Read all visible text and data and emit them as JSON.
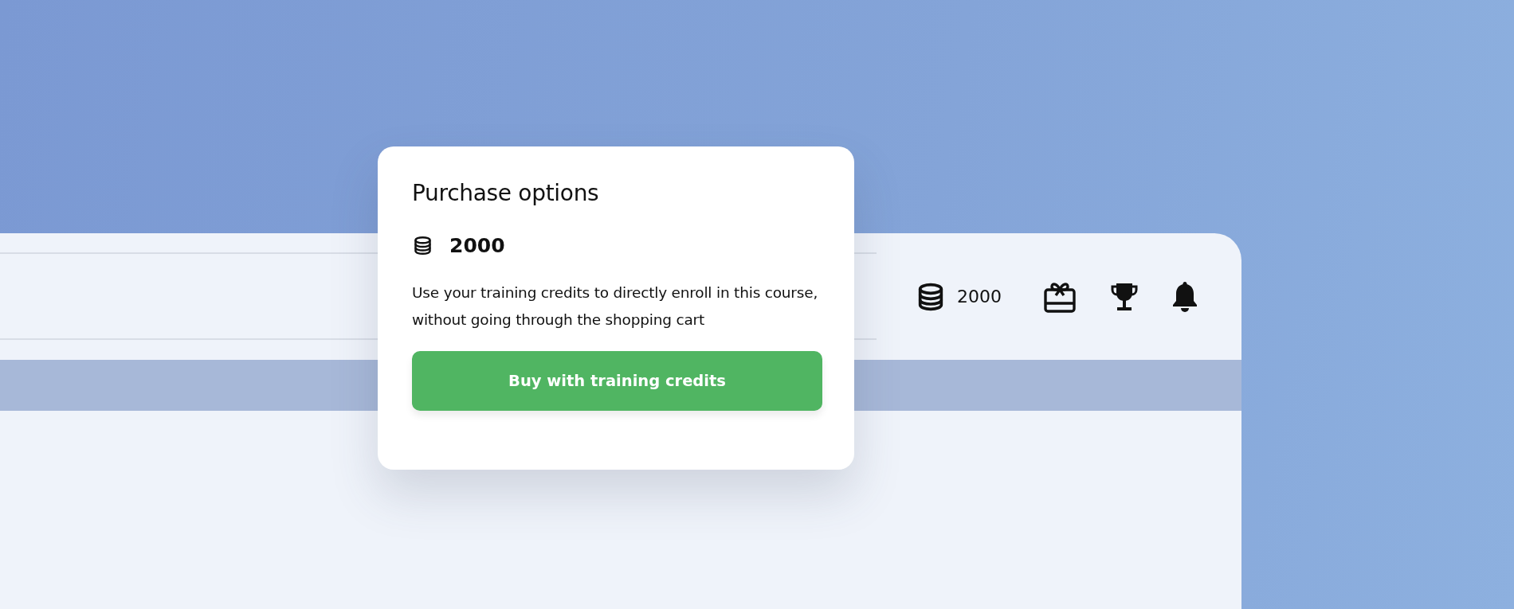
{
  "header": {
    "credits": "2000"
  },
  "popup": {
    "title": "Purchase options",
    "credits": "2000",
    "description": "Use your training credits to directly enroll in this course, without going through the shopping cart",
    "button": "Buy with training credits"
  }
}
